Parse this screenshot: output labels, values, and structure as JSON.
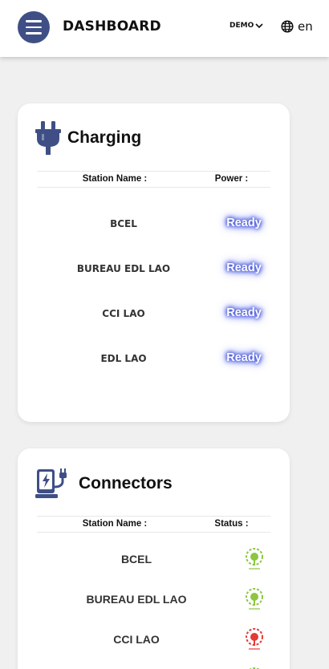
{
  "header": {
    "title": "DASHBOARD",
    "account_label": "DEMO",
    "language": "en",
    "brand_color": "#3f4f86"
  },
  "charging": {
    "title": "Charging",
    "columns": [
      "Station Name :",
      "Power :"
    ],
    "rows": [
      {
        "name": "BCEL",
        "power": "Ready"
      },
      {
        "name": "BUREAU EDL LAO",
        "power": "Ready"
      },
      {
        "name": "CCI LAO",
        "power": "Ready"
      },
      {
        "name": "EDL LAO",
        "power": "Ready"
      }
    ]
  },
  "connectors": {
    "title": "Connectors",
    "columns": [
      "Station Name :",
      "Status :"
    ],
    "rows": [
      {
        "name": "BCEL",
        "status_icon": "available-plug-icon",
        "status_color": "#8cc63f"
      },
      {
        "name": "BUREAU EDL LAO",
        "status_icon": "available-plug-icon",
        "status_color": "#8cc63f"
      },
      {
        "name": "CCI LAO",
        "status_icon": "unavailable-plug-icon",
        "status_color": "#e53935"
      }
    ]
  }
}
